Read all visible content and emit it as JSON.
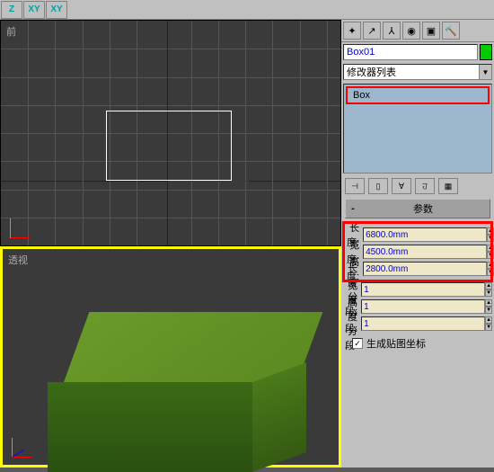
{
  "toolbar": {
    "z_label": "Z",
    "xy_label": "XY",
    "xy2_label": "XY"
  },
  "viewports": {
    "front_label": "前",
    "perspective_label": "透视"
  },
  "object": {
    "name": "Box01"
  },
  "modifier": {
    "dropdown_label": "修改器列表",
    "stack_item": "Box"
  },
  "params": {
    "header": "参数",
    "header_minus": "-",
    "length_label": "长度:",
    "length_value": "6800.0mm",
    "width_label": "宽度:",
    "width_value": "4500.0mm",
    "height_label": "高度:",
    "height_value": "2800.0mm",
    "lseg_label": "长度分段:",
    "lseg_value": "1",
    "wseg_label": "宽度分段:",
    "wseg_value": "1",
    "hseg_label": "高度分段:",
    "hseg_value": "1",
    "gen_uvw_label": "生成贴图坐标",
    "gen_uvw_check": "✓"
  },
  "colors": {
    "accent_highlight": "#ff0000",
    "box_color": "#5a8a20",
    "object_swatch": "#00cc00"
  }
}
